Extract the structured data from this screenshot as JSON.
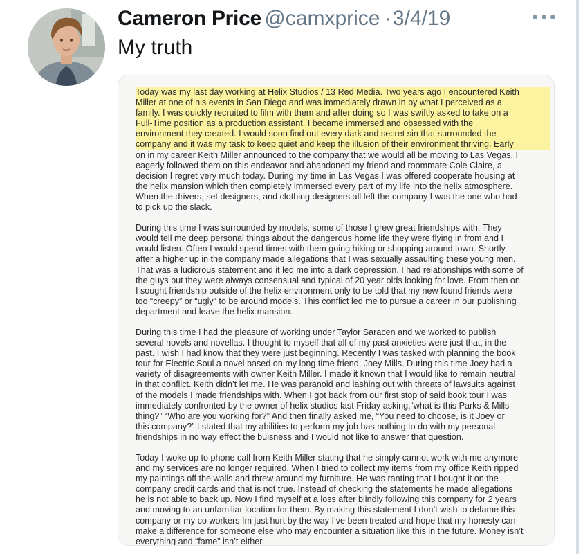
{
  "tweet": {
    "display_name": "Cameron Price",
    "handle": "@camxprice",
    "separator": "·",
    "date": "3/4/19",
    "text": "My truth"
  },
  "colors": {
    "highlight": "#fff05a",
    "secondary_text": "#657786",
    "border": "#e1e8ed"
  },
  "letter": {
    "paragraphs": [
      {
        "lines": [
          "Today was my last day working at Helix Studios / 13 Red Media. Two years ago I encountered Keith",
          "Miller at one of his events in San Diego and was immediately drawn in by what I perceived as a",
          "family. I was quickly recruited to film with them and after doing so I was swiftly asked to take on a",
          "Full-Time position as a production assistant. I became immersed and obsessed with the",
          "environment they created. I would soon find out every dark and secret sin that surrounded the",
          "company and it was my task to keep quiet and keep the illusion of their environment thriving. Early",
          "on in my career Keith Miller announced to the company that we would all be moving to Las Vegas. I",
          "eagerly followed them on this endeavor and abandoned my friend and roommate Cole Claire, a",
          "decision I regret very much today. During my time in Las Vegas I was offered cooperate housing at",
          "the helix mansion which then completely immersed every part of my life into the helix atmosphere.",
          "When the drivers, set designers, and clothing designers all left the company I was the one who had",
          "to pick up the slack."
        ]
      },
      {
        "lines": [
          "During this time I was surrounded by models, some of those I grew great friendships with. They",
          "would tell me deep personal things about the dangerous home life they were flying in from and I",
          "would listen. Often I would spend times with them going hiking or shopping around town. Shortly",
          "after a higher up in the company made allegations that I was sexually assaulting these young men.",
          "That was a ludicrous statement and it led me into a dark depression. I had relationships with some of",
          "the guys but they were always consensual and typical of 20 year olds looking for love. From then on",
          "I sought friendship outside of the helix environment only to be told that my new found friends were",
          "too “creepy” or “ugly” to be around models. This conflict led me to pursue a career in our publishing",
          "department and leave the helix mansion."
        ]
      },
      {
        "lines": [
          "During this time I had the pleasure of working under Taylor Saracen and we worked to publish",
          "several novels and novellas. I thought to myself that all of my past anxieties were just that, in the",
          "past. I wish I had know that they were just beginning. Recently I was tasked with planning the book",
          "tour for Electric Soul a novel based on my long time friend, Joey Mills. During this time Joey had a",
          "variety of disagreements with owner Keith Miller. I made it known that I would like to remain neutral",
          "in that conflict. Keith didn’t let me. He was paranoid and lashing out with threats of lawsuits against",
          "of the models I made friendships with. When I got back from our first stop of said book tour I was",
          "immediately confronted by the owner of helix studios last Friday asking,“what is this Parks & Mills",
          "thing?” “Who are you working for?” And then finally asked me, “You need to choose, is it Joey or",
          "this company?” I stated that my abilities to perform my job has nothing to do with my personal",
          "friendships in no way effect the buisness and I would not like to answer that question."
        ]
      },
      {
        "lines": [
          "Today I woke up to phone call from Keith Miller stating that he simply cannot work with me anymore",
          "and my services are no longer required. When I tried to collect my items from my office Keith ripped",
          "my paintings off the walls and threw around my furniture. He was ranting that I bought it on the",
          "company credit cards and that is not true. Instead of checking the statements he made allegations",
          "he is not able to back up. Now I find myself at a loss after blindly following this company for 2 years",
          "and moving to an unfamiliar location for them. By making this statement I don’t wish to defame this",
          "company or my co workers Im just hurt by the way I’ve been treated and hope that my honesty can",
          "make a difference for someone else who may encounter a situation like this in the future. Money isn’t",
          "everything and “fame” isn’t either."
        ]
      }
    ]
  }
}
